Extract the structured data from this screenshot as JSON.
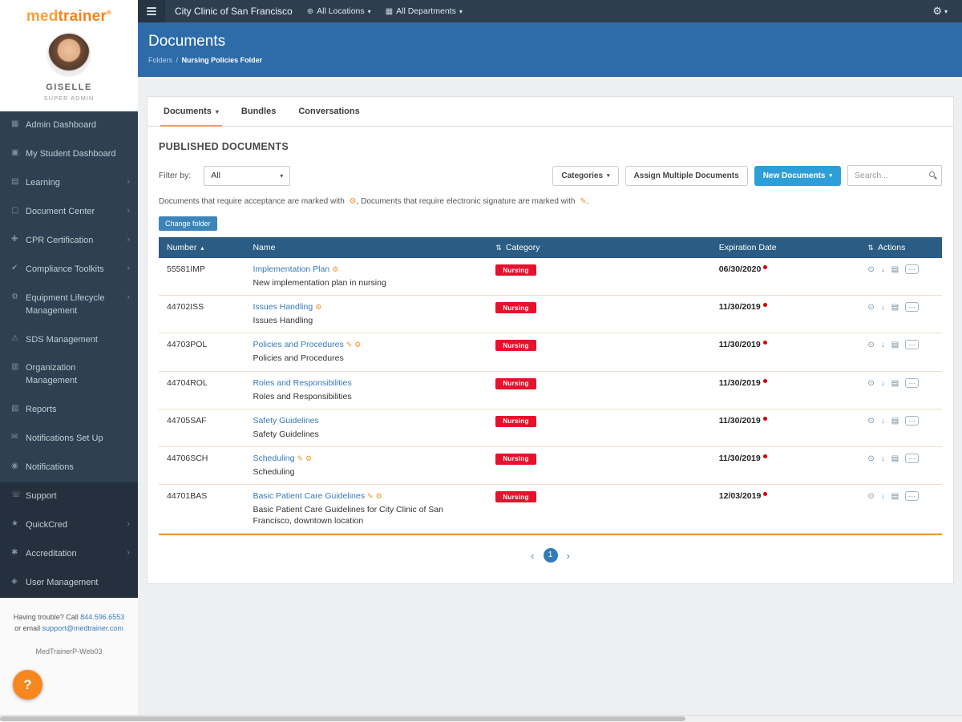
{
  "brand": {
    "logo_med": "med",
    "logo_trainer": "trainer",
    "logo_reg": "®"
  },
  "user": {
    "name": "GISELLE",
    "role": "SUPER ADMIN"
  },
  "topbar": {
    "clinic": "City Clinic of San Francisco",
    "locations_label": "All Locations",
    "departments_label": "All Departments"
  },
  "page_header": {
    "title": "Documents",
    "breadcrumb_root": "Folders",
    "breadcrumb_sep": "/",
    "breadcrumb_current": "Nursing Policies Folder"
  },
  "tabs": [
    {
      "label": "Documents"
    },
    {
      "label": "Bundles"
    },
    {
      "label": "Conversations"
    }
  ],
  "published": {
    "heading": "PUBLISHED DOCUMENTS",
    "filter_label": "Filter by:",
    "filter_value": "All",
    "categories_button": "Categories",
    "assign_button": "Assign Multiple Documents",
    "new_documents_button": "New Documents",
    "search_placeholder": "Search...",
    "legend_pre": "Documents that require acceptance are marked with",
    "legend_mid": ", Documents that require electronic signature are marked with",
    "legend_post": ".",
    "change_folder_button": "Change folder"
  },
  "table": {
    "columns": {
      "number": "Number",
      "name": "Name",
      "category": "Category",
      "expiration": "Expiration Date",
      "actions": "Actions"
    },
    "rows": [
      {
        "number": "55581IMP",
        "name": "Implementation Plan",
        "description": "New implementation plan in nursing",
        "category": "Nursing",
        "expiration": "06/30/2020",
        "acceptance": true,
        "signature": false
      },
      {
        "number": "44702ISS",
        "name": "Issues Handling",
        "description": "Issues Handling",
        "category": "Nursing",
        "expiration": "11/30/2019",
        "acceptance": true,
        "signature": false
      },
      {
        "number": "44703POL",
        "name": "Policies and Procedures",
        "description": "Policies and Procedures",
        "category": "Nursing",
        "expiration": "11/30/2019",
        "acceptance": true,
        "signature": true
      },
      {
        "number": "44704ROL",
        "name": "Roles and Responsibilities",
        "description": "Roles and Responsibilities",
        "category": "Nursing",
        "expiration": "11/30/2019",
        "acceptance": false,
        "signature": false
      },
      {
        "number": "44705SAF",
        "name": "Safety Guidelines",
        "description": "Safety Guidelines",
        "category": "Nursing",
        "expiration": "11/30/2019",
        "acceptance": false,
        "signature": false
      },
      {
        "number": "44706SCH",
        "name": "Scheduling",
        "description": "Scheduling",
        "category": "Nursing",
        "expiration": "11/30/2019",
        "acceptance": true,
        "signature": true
      },
      {
        "number": "44701BAS",
        "name": "Basic Patient Care Guidelines",
        "description": "Basic Patient Care Guidelines for City Clinic of San Francisco, downtown location",
        "category": "Nursing",
        "expiration": "12/03/2019",
        "acceptance": true,
        "signature": true
      }
    ]
  },
  "pagination": {
    "prev": "‹",
    "current": "1",
    "next": "›"
  },
  "sidebar": {
    "items": [
      {
        "label": "Admin Dashboard",
        "icon": "dashboard-icon",
        "glyph": "▦",
        "chevron": false,
        "dark": false
      },
      {
        "label": "My Student Dashboard",
        "icon": "student-dashboard-icon",
        "glyph": "▣",
        "chevron": false,
        "dark": false
      },
      {
        "label": "Learning",
        "icon": "learning-icon",
        "glyph": "▤",
        "chevron": true,
        "dark": false
      },
      {
        "label": "Document Center",
        "icon": "document-center-icon",
        "glyph": "▢",
        "chevron": true,
        "dark": false
      },
      {
        "label": "CPR Certification",
        "icon": "cpr-certification-icon",
        "glyph": "✚",
        "chevron": true,
        "dark": false
      },
      {
        "label": "Compliance Toolkits",
        "icon": "compliance-toolkits-icon",
        "glyph": "✔",
        "chevron": true,
        "dark": false
      },
      {
        "label": "Equipment Lifecycle Management",
        "icon": "equipment-lifecycle-icon",
        "glyph": "⚙",
        "chevron": true,
        "dark": false
      },
      {
        "label": "SDS Management",
        "icon": "sds-management-icon",
        "glyph": "⚠",
        "chevron": false,
        "dark": false
      },
      {
        "label": "Organization Management",
        "icon": "organization-management-icon",
        "glyph": "▥",
        "chevron": false,
        "dark": false
      },
      {
        "label": "Reports",
        "icon": "reports-icon",
        "glyph": "▧",
        "chevron": false,
        "dark": false
      },
      {
        "label": "Notifications Set Up",
        "icon": "notifications-setup-icon",
        "glyph": "✉",
        "chevron": false,
        "dark": false
      },
      {
        "label": "Notifications",
        "icon": "notifications-icon",
        "glyph": "◉",
        "chevron": false,
        "dark": false
      },
      {
        "label": "Support",
        "icon": "support-icon",
        "glyph": "☏",
        "chevron": false,
        "dark": true
      },
      {
        "label": "QuickCred",
        "icon": "quickcred-icon",
        "glyph": "★",
        "chevron": true,
        "dark": true
      },
      {
        "label": "Accreditation",
        "icon": "accreditation-icon",
        "glyph": "✱",
        "chevron": true,
        "dark": true
      },
      {
        "label": "User Management",
        "icon": "user-management-icon",
        "glyph": "◈",
        "chevron": false,
        "dark": true
      }
    ]
  },
  "sidebar_footer": {
    "trouble_pre": "Having trouble? Call",
    "phone": "844.596.6553",
    "trouble_mid": "or email",
    "email": "support@medtrainer.com",
    "server": "MedTrainerP-Web03",
    "help": "?"
  },
  "icons": {
    "chevron_right": "›",
    "caret_down": "▾",
    "locations": "⊕",
    "departments": "▦",
    "settings_gear": "⚙",
    "sort_asc": "▴",
    "sort_both": "⇅",
    "acceptance": "⚙",
    "signature": "✎",
    "preview": "⊙",
    "download": "↓",
    "versions": "▤",
    "more": "⋯"
  }
}
